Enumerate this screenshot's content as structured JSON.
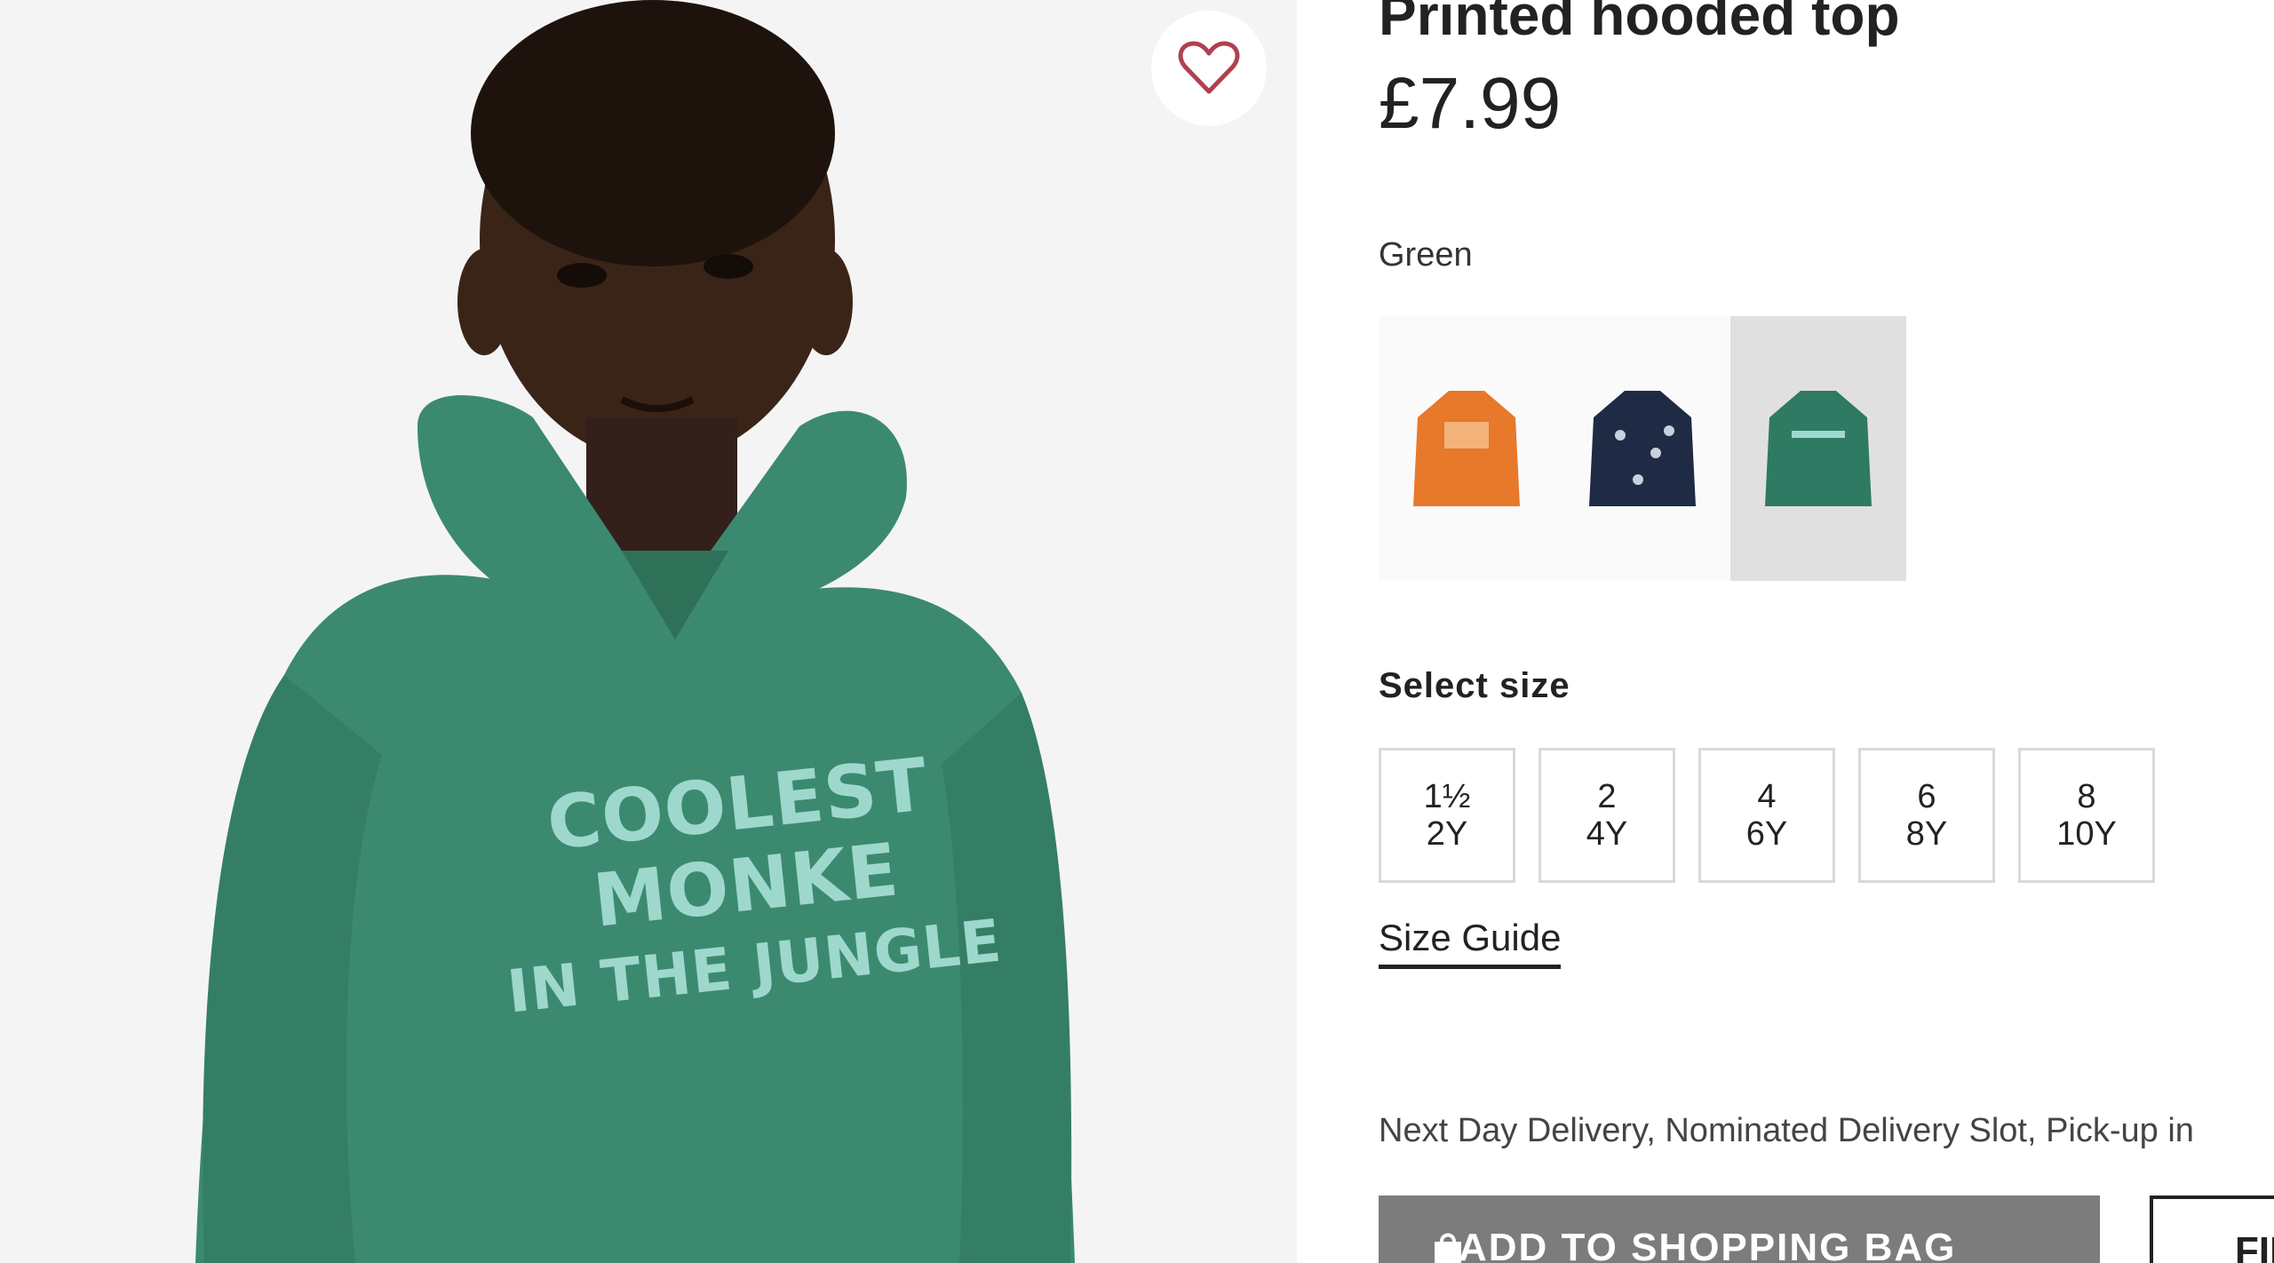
{
  "product": {
    "title": "Printed hooded top",
    "price": "£7.99",
    "colour": "Green"
  },
  "image": {
    "hoodie_text_line1": "COOLEST MONKE",
    "hoodie_text_line2": "IN THE JUNGLE",
    "favourite_icon": "heart-icon"
  },
  "swatches": [
    {
      "name": "orange-hoodie",
      "color": "#e8782a",
      "selected": false
    },
    {
      "name": "navy-hoodie",
      "color": "#1f2a44",
      "selected": false
    },
    {
      "name": "green-hoodie",
      "color": "#2f7a62",
      "selected": true
    }
  ],
  "sizes": {
    "label": "Select size",
    "options": [
      {
        "top": "1½",
        "bottom": "2Y"
      },
      {
        "top": "2",
        "bottom": "4Y"
      },
      {
        "top": "4",
        "bottom": "6Y"
      },
      {
        "top": "6",
        "bottom": "8Y"
      },
      {
        "top": "8",
        "bottom": "10Y"
      }
    ],
    "guide": "Size Guide"
  },
  "delivery": "Next Day Delivery, Nominated Delivery Slot, Pick-up in",
  "actions": {
    "add_to_bag": "ADD TO SHOPPING BAG",
    "find_in_store": "FIND IN STORE",
    "bag_icon": "shopping-bag-icon"
  },
  "colors": {
    "hoodie_green": "#3b8a70",
    "print_mint": "#9ed8cc",
    "button_grey": "#7c7c7c"
  }
}
